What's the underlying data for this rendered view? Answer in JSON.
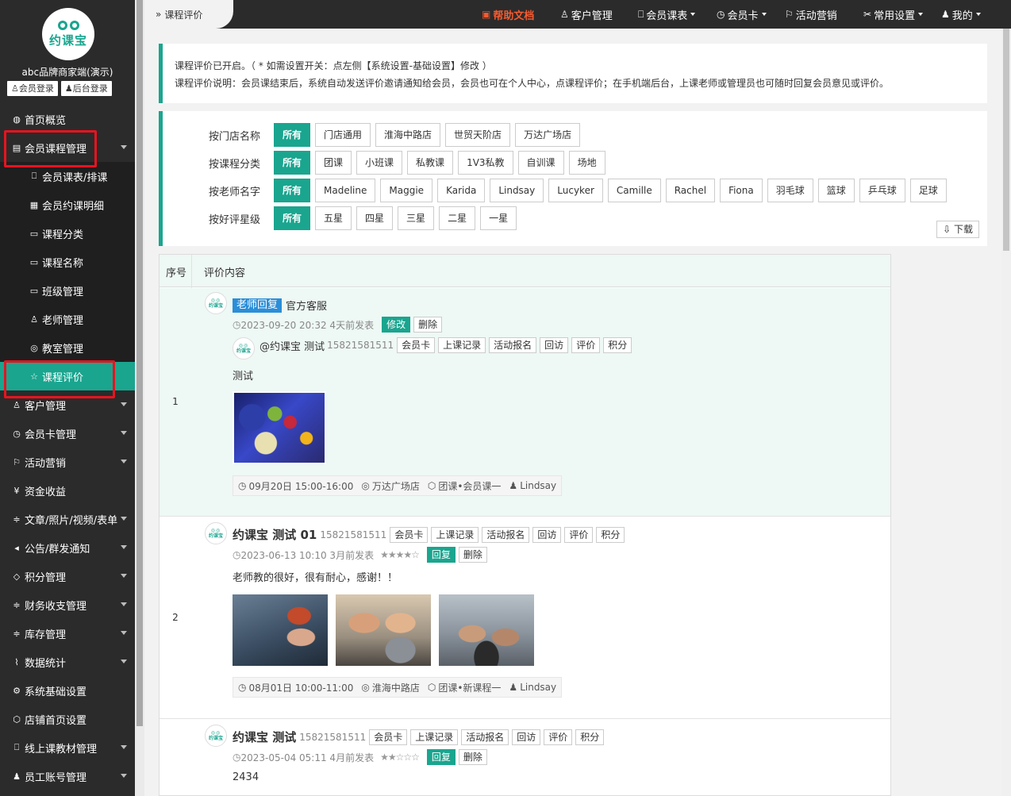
{
  "brand": {
    "logo_text": "约课宝",
    "shop_name": "abc品牌商家端(演示)",
    "member_login": "会员登录",
    "admin_login": "后台登录"
  },
  "sidebar": {
    "items": [
      {
        "label": "首页概览",
        "icon": "globe-icon"
      },
      {
        "label": "会员课程管理",
        "icon": "document-icon"
      },
      {
        "label": "会员课表/排课",
        "icon": "book-icon"
      },
      {
        "label": "会员约课明细",
        "icon": "list-icon"
      },
      {
        "label": "课程分类",
        "icon": "file-icon"
      },
      {
        "label": "课程名称",
        "icon": "file-icon"
      },
      {
        "label": "班级管理",
        "icon": "file-icon"
      },
      {
        "label": "老师管理",
        "icon": "user-icon"
      },
      {
        "label": "教室管理",
        "icon": "location-icon"
      },
      {
        "label": "课程评价",
        "icon": "star-icon"
      },
      {
        "label": "客户管理",
        "icon": "user-icon"
      },
      {
        "label": "会员卡管理",
        "icon": "clock-icon"
      },
      {
        "label": "活动营销",
        "icon": "flag-icon"
      },
      {
        "label": "资金收益",
        "icon": "yen-icon"
      },
      {
        "label": "文章/照片/视频/表单",
        "icon": "sliders-icon"
      },
      {
        "label": "公告/群发通知",
        "icon": "speaker-icon"
      },
      {
        "label": "积分管理",
        "icon": "diamond-icon"
      },
      {
        "label": "财务收支管理",
        "icon": "sliders-icon"
      },
      {
        "label": "库存管理",
        "icon": "sliders-icon"
      },
      {
        "label": "数据统计",
        "icon": "pulse-icon"
      },
      {
        "label": "系统基础设置",
        "icon": "gear-icon"
      },
      {
        "label": "店铺首页设置",
        "icon": "cube-icon"
      },
      {
        "label": "线上课教材管理",
        "icon": "book-icon"
      },
      {
        "label": "员工账号管理",
        "icon": "person-icon"
      }
    ]
  },
  "topbar": {
    "breadcrumb": "课程评价",
    "help": "帮助文档",
    "customers": "客户管理",
    "schedule": "会员课表",
    "card": "会员卡",
    "marketing": "活动营销",
    "settings": "常用设置",
    "mine": "我的"
  },
  "notice": {
    "line1": "课程评价已开启。（ * 如需设置开关：点左侧【系统设置-基础设置】修改 ）",
    "line2": "课程评价说明：会员课结束后，系统自动发送评价邀请通知给会员，会员也可在个人中心，点课程评价；在手机端后台，上课老师或管理员也可随时回复会员意见或评价。"
  },
  "filters": [
    {
      "label": "按门店名称",
      "options": [
        "所有",
        "门店通用",
        "淮海中路店",
        "世贸天阶店",
        "万达广场店"
      ]
    },
    {
      "label": "按课程分类",
      "options": [
        "所有",
        "团课",
        "小班课",
        "私教课",
        "1V3私教",
        "自训课",
        "场地"
      ]
    },
    {
      "label": "按老师名字",
      "options": [
        "所有",
        "Madeline",
        "Maggie",
        "Karida",
        "Lindsay",
        "Lucyker",
        "Camille",
        "Rachel",
        "Fiona",
        "羽毛球",
        "篮球",
        "乒乓球",
        "足球"
      ]
    },
    {
      "label": "按好评星级",
      "options": [
        "所有",
        "五星",
        "四星",
        "三星",
        "二星",
        "一星"
      ]
    }
  ],
  "download": "下载",
  "table": {
    "col_no": "序号",
    "col_content": "评价内容"
  },
  "actions": {
    "member_card": "会员卡",
    "records": "上课记录",
    "signup": "活动报名",
    "visit": "回访",
    "review": "评价",
    "points": "积分",
    "reply": "回复",
    "delete": "删除",
    "edit": "修改"
  },
  "reviews": [
    {
      "no": "1",
      "reply_tag": "老师回复",
      "replier": "官方客服",
      "time": "2023-09-20 20:32 4天前发表",
      "member": "@约课宝 测试",
      "phone": "15821581511",
      "text": "测试",
      "session_time": "09月20日 15:00-16:00",
      "store": "万达广场店",
      "course": "团课•会员课一",
      "teacher": "Lindsay"
    },
    {
      "no": "2",
      "name": "约课宝 测试 01",
      "phone": "15821581511",
      "time": "2023-06-13 10:10 3月前发表",
      "stars": "★★★★☆",
      "rating": 4,
      "text": "老师教的很好，很有耐心，感谢！！",
      "session_time": "08月01日 10:00-11:00",
      "store": "淮海中路店",
      "course": "团课•新课程一",
      "teacher": "Lindsay"
    },
    {
      "no": "",
      "name": "约课宝 测试",
      "phone": "15821581511",
      "time": "2023-05-04 05:11 4月前发表",
      "stars": "★★☆☆☆",
      "rating": 2,
      "text": "2434"
    }
  ]
}
